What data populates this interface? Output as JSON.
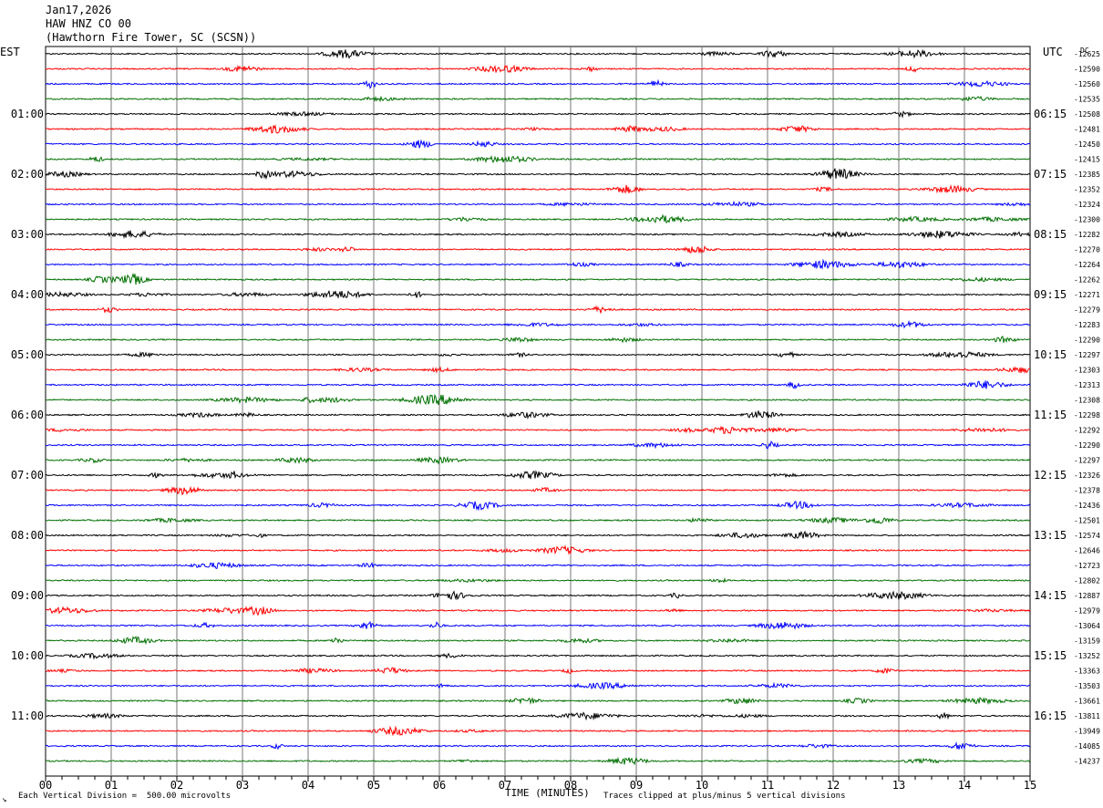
{
  "header": {
    "date": "Jan17,2026",
    "channel": "HAW HNZ CO 00",
    "station": "(Hawthorn Fire Tower, SC (SCSN))"
  },
  "footer": {
    "scale_note": "Each Vertical Division =  500.00 microvolts",
    "clip_note": "Traces clipped at plus/minus 5 vertical divisions",
    "corner_mark": "↘"
  },
  "chart_data": {
    "type": "line",
    "title": "",
    "xlabel": "TIME (MINUTES)",
    "ylabel_left": "EST",
    "ylabel_right": "UTC",
    "dc_label": "DC",
    "xlim": [
      0,
      15
    ],
    "x_ticks": [
      "00",
      "01",
      "02",
      "03",
      "04",
      "05",
      "06",
      "07",
      "08",
      "09",
      "10",
      "11",
      "12",
      "13",
      "14",
      "15"
    ],
    "trace_colors": [
      "#000000",
      "#ff0000",
      "#0000ff",
      "#007000"
    ],
    "grid": true,
    "left_hour_labels": [
      "01:00",
      "02:00",
      "03:00",
      "04:00",
      "05:00",
      "06:00",
      "07:00",
      "08:00",
      "09:00",
      "10:00",
      "11:00"
    ],
    "right_hour_labels": [
      "06:15",
      "07:15",
      "08:15",
      "09:15",
      "10:15",
      "11:15",
      "12:15",
      "13:15",
      "14:15",
      "15:15",
      "16:15"
    ],
    "dc_offsets": [
      -12625,
      -12590,
      -12560,
      -12535,
      -12508,
      -12481,
      -12450,
      -12415,
      -12385,
      -12352,
      -12324,
      -12300,
      -12282,
      -12270,
      -12264,
      -12262,
      -12271,
      -12279,
      -12283,
      -12290,
      -12297,
      -12303,
      -12313,
      -12308,
      -12298,
      -12292,
      -12290,
      -12297,
      -12326,
      -12378,
      -12436,
      -12501,
      -12574,
      -12646,
      -12723,
      -12802,
      -12887,
      -12979,
      -13064,
      -13159,
      -13252,
      -13363,
      -13503,
      -13661,
      -13811,
      -13949,
      -14085,
      -14237
    ],
    "trace_count": 48,
    "minutes_per_trace": 15
  }
}
